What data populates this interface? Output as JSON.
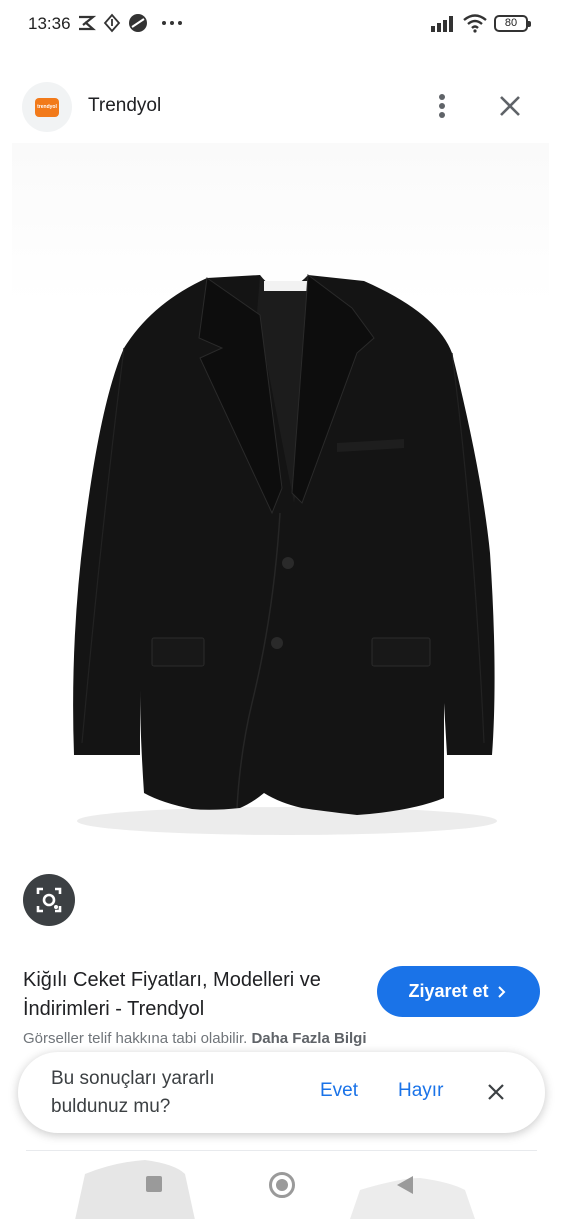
{
  "status_bar": {
    "time": "13:36",
    "battery": "80"
  },
  "header": {
    "site_name": "Trendyol",
    "logo_text": "trendyol"
  },
  "result": {
    "title": "Kiğılı Ceket Fiyatları, Modelleri ve İndirimleri - Trendyol",
    "visit_label": "Ziyaret et",
    "copyright_text": "Görseller telif hakkına tabi olabilir.",
    "more_info_label": "Daha Fazla Bilgi"
  },
  "feedback": {
    "question": "Bu sonuçları yararlı buldunuz mu?",
    "yes_label": "Evet",
    "no_label": "Hayır"
  },
  "colors": {
    "accent": "#1a73e8",
    "brand": "#f27a1a",
    "jacket": "#141414"
  },
  "icons": [
    "scissors-icon",
    "arrow-icon",
    "circle-icon",
    "more-icon",
    "signal-icon",
    "wifi-icon",
    "battery-icon",
    "more-vertical-icon",
    "close-icon",
    "lens-icon",
    "chevron-right-icon",
    "home-icon",
    "recent-icon",
    "back-icon"
  ]
}
